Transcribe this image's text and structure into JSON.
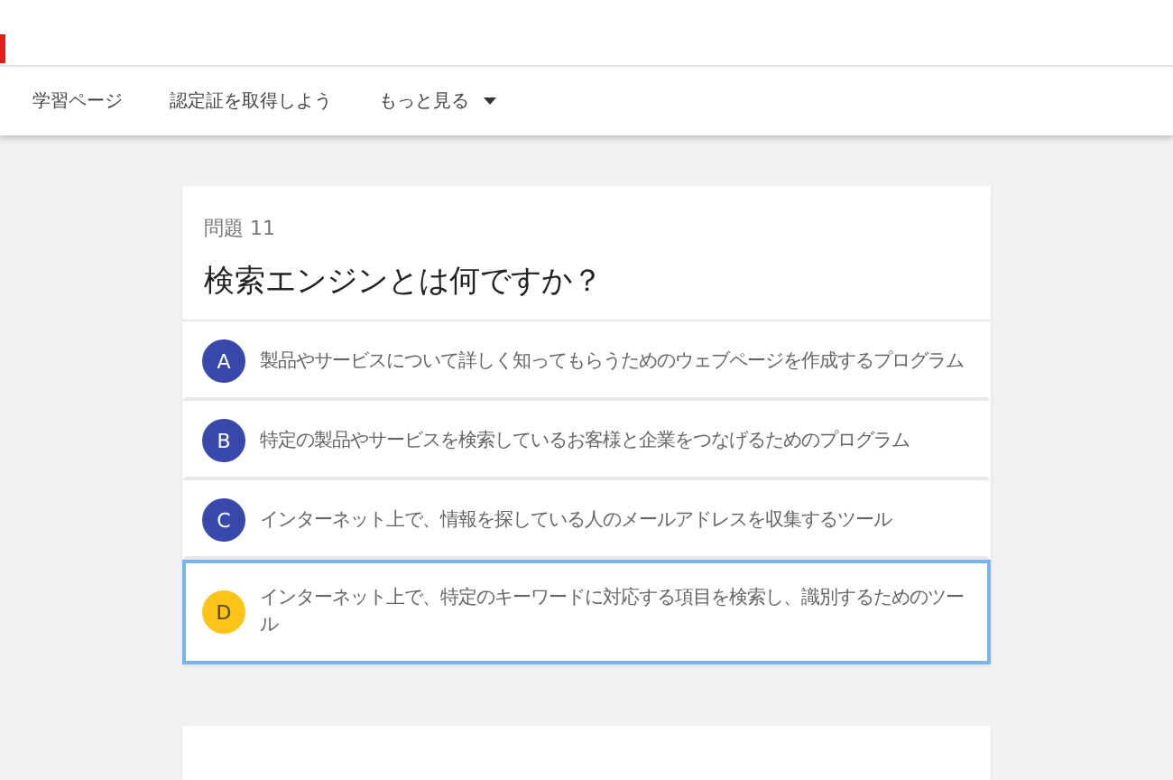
{
  "nav": {
    "items": [
      {
        "label": "学習ページ",
        "kind": "link"
      },
      {
        "label": "認定証を取得しよう",
        "kind": "link"
      },
      {
        "label": "もっと見る",
        "kind": "menu"
      }
    ]
  },
  "question": {
    "number": "問題 11",
    "title": "検索エンジンとは何ですか？",
    "options": [
      {
        "letter": "A",
        "text": "製品やサービスについて詳しく知ってもらうためのウェブページを作成するプログラム",
        "selected": false
      },
      {
        "letter": "B",
        "text": "特定の製品やサービスを検索しているお客様と企業をつなげるためのプログラム",
        "selected": false
      },
      {
        "letter": "C",
        "text": "インターネット上で、情報を探している人のメールアドレスを収集するツール",
        "selected": false
      },
      {
        "letter": "D",
        "text": "インターネット上で、特定のキーワードに対応する項目を検索し、識別するためのツール",
        "selected": true
      }
    ]
  }
}
